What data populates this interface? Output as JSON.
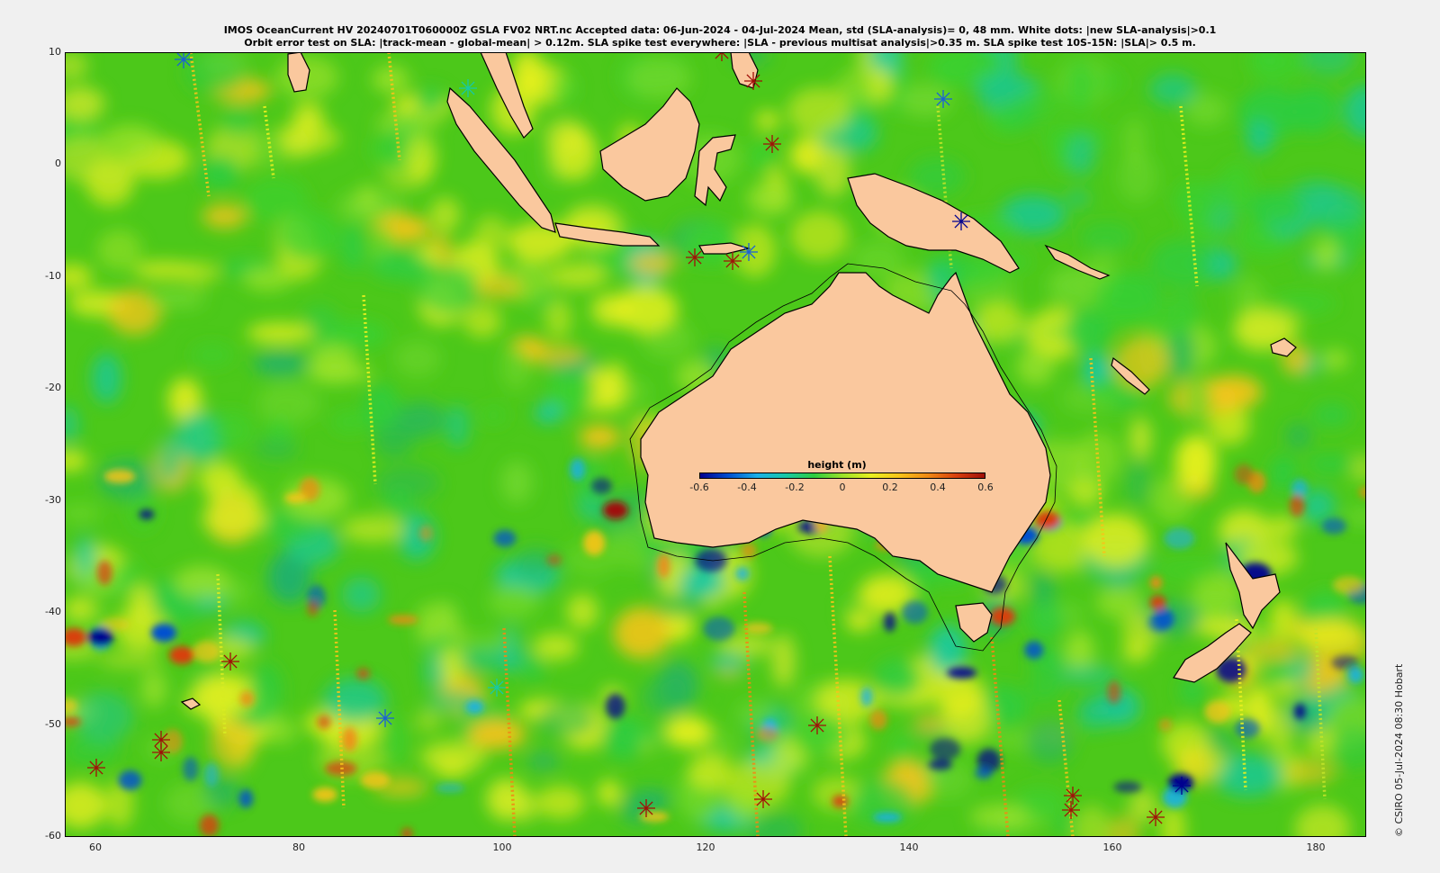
{
  "title": {
    "line1": "IMOS OceanCurrent HV 20240701T060000Z GSLA FV02 NRT.nc  Accepted data: 06-Jun-2024 - 04-Jul-2024 Mean, std (SLA-analysis)= 0, 48 mm. White dots: |new SLA-analysis|>0.1",
    "line2": "Orbit error test on SLA: |track-mean  - global-mean| > 0.12m.  SLA spike test everywhere: |SLA - previous multisat analysis|>0.35 m. SLA spike test 10S-15N: |SLA|> 0.5 m."
  },
  "axes": {
    "lon_range": [
      57,
      185
    ],
    "lat_range": [
      -60,
      10
    ],
    "x_ticks": [
      "60",
      "80",
      "100",
      "120",
      "140",
      "160",
      "180"
    ],
    "y_ticks": [
      "10",
      "0",
      "-10",
      "-20",
      "-30",
      "-40",
      "-50",
      "-60"
    ]
  },
  "colorbar": {
    "label": "height (m)",
    "ticks": [
      "-0.6",
      "-0.4",
      "-0.2",
      "0",
      "0.2",
      "0.4",
      "0.6"
    ],
    "range": [
      -0.6,
      0.6
    ],
    "colors": [
      "#00008f",
      "#0050d0",
      "#1ab0e8",
      "#17c9a8",
      "#2ecc40",
      "#9be22a",
      "#e8f020",
      "#f7c41a",
      "#f08a14",
      "#d8400e",
      "#a01008"
    ]
  },
  "colors": {
    "land": "#fac89e",
    "ocean_base": "#4cc81a",
    "coast": "#000000"
  },
  "copyright": "© CSIRO 05-Jul-2024 08:30 Hobart"
}
